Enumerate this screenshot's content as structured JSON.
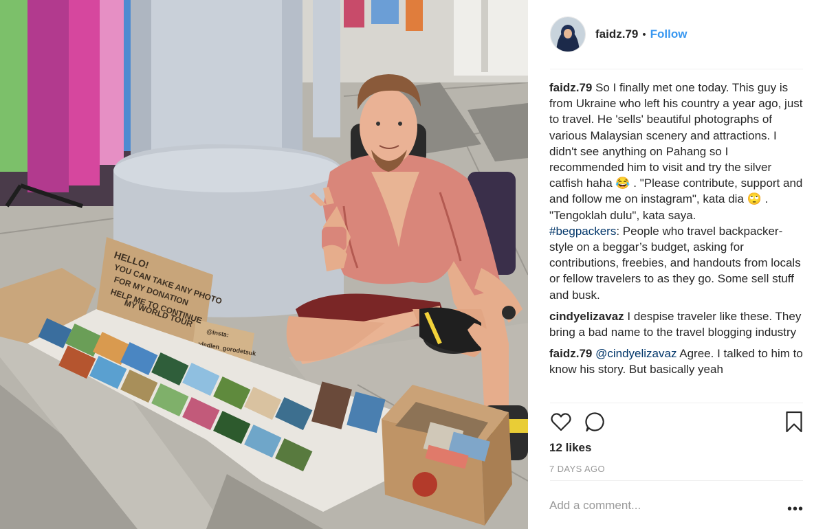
{
  "post": {
    "username": "faidz.79",
    "separator": "•",
    "follow_label": "Follow"
  },
  "sign": {
    "line1": "HELLO!",
    "line2": "YOU CAN TAKE ANY PHOTO",
    "line3": "FOR MY DONATION",
    "line4": "HELP ME TO CONTINUE",
    "line5": "MY WORLD TOUR",
    "insta1": "@insta:",
    "insta2": "vledlen_gorodetsuk"
  },
  "comments": {
    "c1_user": "faidz.79",
    "c1_text": "So I finally met one today. This guy is from Ukraine who left his country a year ago, just to travel. He 'sells' beautiful photographs of various Malaysian scenery and attractions. I didn't see anything on Pahang so I recommended him to visit and try the silver catfish haha 😂 . \"Please contribute, support and and follow me on instagram\", kata dia 🙄 . \"Tengoklah dulu\", kata saya.",
    "c1_tag": "#begpackers",
    "c1_tag_text": ": People who travel backpacker-style on a beggar’s budget, asking for contributions, freebies, and handouts from locals or fellow travelers to as they go. Some sell stuff and busk.",
    "c2_user": "cindyelizavaz",
    "c2_text": "I despise traveler like these. They bring a bad name to the travel blogging industry",
    "c3_user": "faidz.79",
    "c3_mention": "@cindyelizavaz",
    "c3_text": "Agree. I talked to him to know his story. But basically yeah"
  },
  "stats": {
    "likes": "12 likes",
    "date": "7 DAYS AGO"
  },
  "composer": {
    "placeholder": "Add a comment...",
    "more_label": "•••"
  },
  "colors": {
    "link_blue": "#3897f0",
    "text": "#262626",
    "muted": "#999999",
    "hashtag": "#003569"
  }
}
